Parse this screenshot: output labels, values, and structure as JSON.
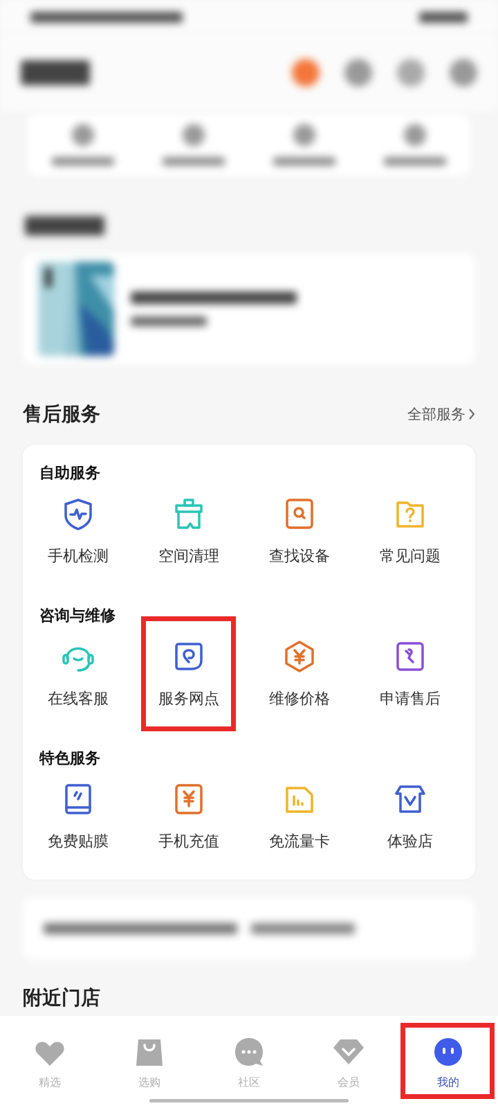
{
  "after_sales": {
    "title": "售后服务",
    "more_link": "全部服务",
    "sections": [
      {
        "title": "自助服务",
        "items": [
          {
            "label": "手机检测",
            "kind": "shield",
            "color": "#3f5fd0",
            "highlighted": false
          },
          {
            "label": "空间清理",
            "kind": "brush",
            "color": "#2bc4b6",
            "highlighted": false
          },
          {
            "label": "查找设备",
            "kind": "search",
            "color": "#e0702a",
            "highlighted": false
          },
          {
            "label": "常见问题",
            "kind": "folder",
            "color": "#f0b429",
            "highlighted": false
          }
        ]
      },
      {
        "title": "咨询与维修",
        "items": [
          {
            "label": "在线客服",
            "kind": "headset",
            "color": "#2bc4b6",
            "highlighted": false
          },
          {
            "label": "服务网点",
            "kind": "pin",
            "color": "#3f5fd0",
            "highlighted": true
          },
          {
            "label": "维修价格",
            "kind": "hexyen",
            "color": "#e0702a",
            "highlighted": false
          },
          {
            "label": "申请售后",
            "kind": "wrench",
            "color": "#8a4fd8",
            "highlighted": false
          }
        ]
      },
      {
        "title": "特色服务",
        "items": [
          {
            "label": "免费贴膜",
            "kind": "film",
            "color": "#3f5fd0",
            "highlighted": false
          },
          {
            "label": "手机充值",
            "kind": "yen",
            "color": "#e0702a",
            "highlighted": false
          },
          {
            "label": "免流量卡",
            "kind": "sim",
            "color": "#f0b429",
            "highlighted": false
          },
          {
            "label": "体验店",
            "kind": "store",
            "color": "#3f5fd0",
            "highlighted": false
          }
        ]
      }
    ]
  },
  "nearby": {
    "title": "附近门店"
  },
  "tab_bar": [
    {
      "label": "精选",
      "kind": "heart",
      "selected": false,
      "highlighted": false
    },
    {
      "label": "选购",
      "kind": "bag",
      "selected": false,
      "highlighted": false
    },
    {
      "label": "社区",
      "kind": "chat",
      "selected": false,
      "highlighted": false
    },
    {
      "label": "会员",
      "kind": "diamond",
      "selected": false,
      "highlighted": false
    },
    {
      "label": "我的",
      "kind": "face",
      "selected": true,
      "highlighted": true
    }
  ]
}
